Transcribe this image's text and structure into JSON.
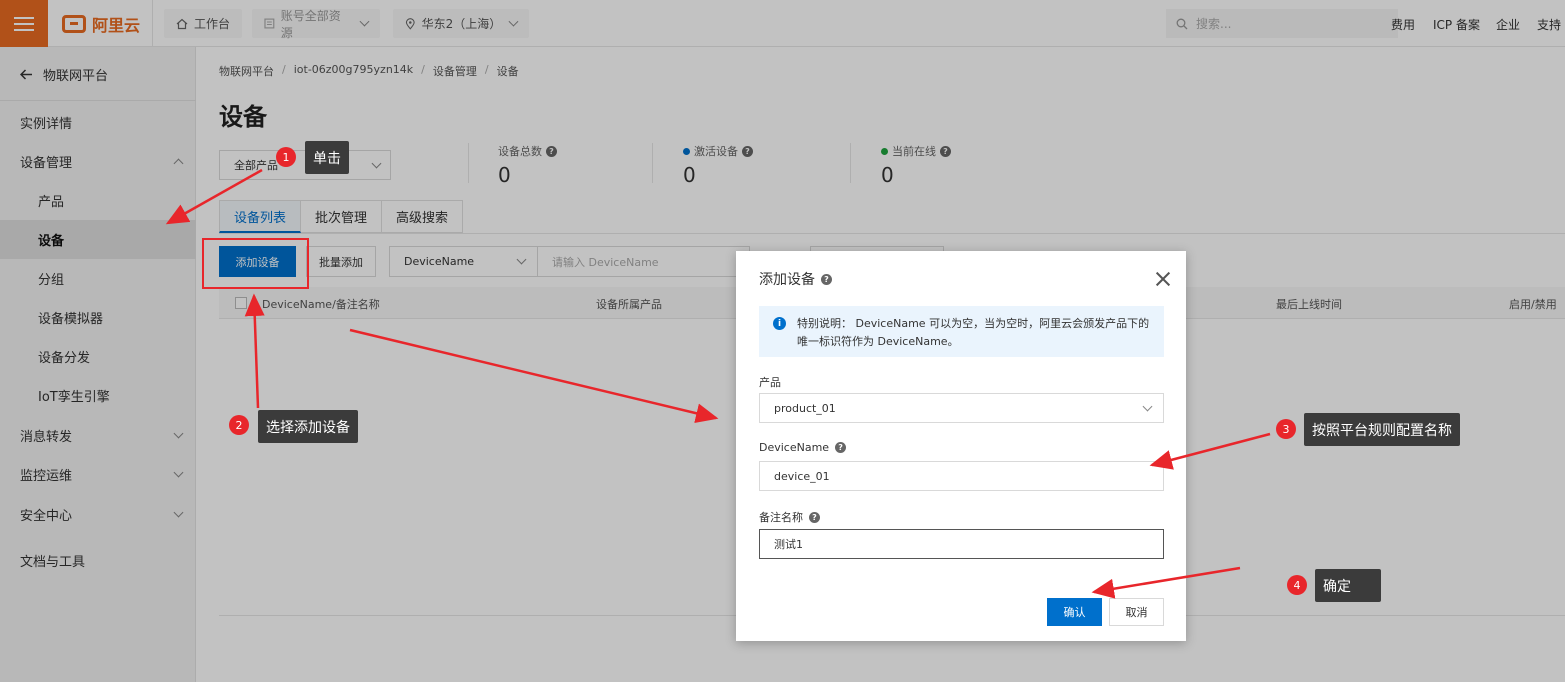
{
  "topbar": {
    "logo_text": "阿里云",
    "workbench": "工作台",
    "account_scope": "账号全部资源",
    "region": "华东2（上海）",
    "search_placeholder": "搜索...",
    "links": [
      "费用",
      "ICP 备案",
      "企业",
      "支持"
    ]
  },
  "sidebar": {
    "back_label": "物联网平台",
    "items": [
      {
        "label": "实例详情",
        "level": 1
      },
      {
        "label": "设备管理",
        "level": 1,
        "expanded": true
      },
      {
        "label": "产品",
        "level": 2
      },
      {
        "label": "设备",
        "level": 2,
        "active": true
      },
      {
        "label": "分组",
        "level": 2
      },
      {
        "label": "设备模拟器",
        "level": 2
      },
      {
        "label": "设备分发",
        "level": 2
      },
      {
        "label": "IoT孪生引擎",
        "level": 2
      },
      {
        "label": "消息转发",
        "level": 1
      },
      {
        "label": "监控运维",
        "level": 1
      },
      {
        "label": "安全中心",
        "level": 1
      },
      {
        "label": "文档与工具",
        "level": 1
      }
    ]
  },
  "main": {
    "breadcrumb": [
      "物联网平台",
      "iot-06z00g795yzn14k",
      "设备管理",
      "设备"
    ],
    "title": "设备",
    "product_select": "全部产品",
    "stats": [
      {
        "label": "设备总数",
        "value": "0"
      },
      {
        "label": "激活设备",
        "value": "0",
        "dot_color": "#0070cc"
      },
      {
        "label": "当前在线",
        "value": "0",
        "dot_color": "#1fa33e"
      }
    ],
    "tabs": [
      "设备列表",
      "批次管理",
      "高级搜索"
    ],
    "add_button": "添加设备",
    "batch_button": "批量添加",
    "filter_field": "DeviceName",
    "filter_placeholder": "请输入 DeviceName",
    "columns": [
      "DeviceName/备注名称",
      "设备所属产品",
      "最后上线时间",
      "启用/禁用"
    ]
  },
  "dialog": {
    "title": "添加设备",
    "notice": "特别说明： DeviceName 可以为空，当为空时，阿里云会颁发产品下的唯一标识符作为 DeviceName。",
    "product_label": "产品",
    "product_value": "product_01",
    "devicename_label": "DeviceName",
    "devicename_value": "device_01",
    "remark_label": "备注名称",
    "remark_value": "测试1",
    "ok": "确认",
    "cancel": "取消"
  },
  "annotations": [
    {
      "num": "1",
      "text": "单击"
    },
    {
      "num": "2",
      "text": "选择添加设备"
    },
    {
      "num": "3",
      "text": "按照平台规则配置名称"
    },
    {
      "num": "4",
      "text": "确定"
    }
  ],
  "colors": {
    "brand": "#e96b21",
    "primary": "#0070cc",
    "annotation": "#e8262b"
  }
}
